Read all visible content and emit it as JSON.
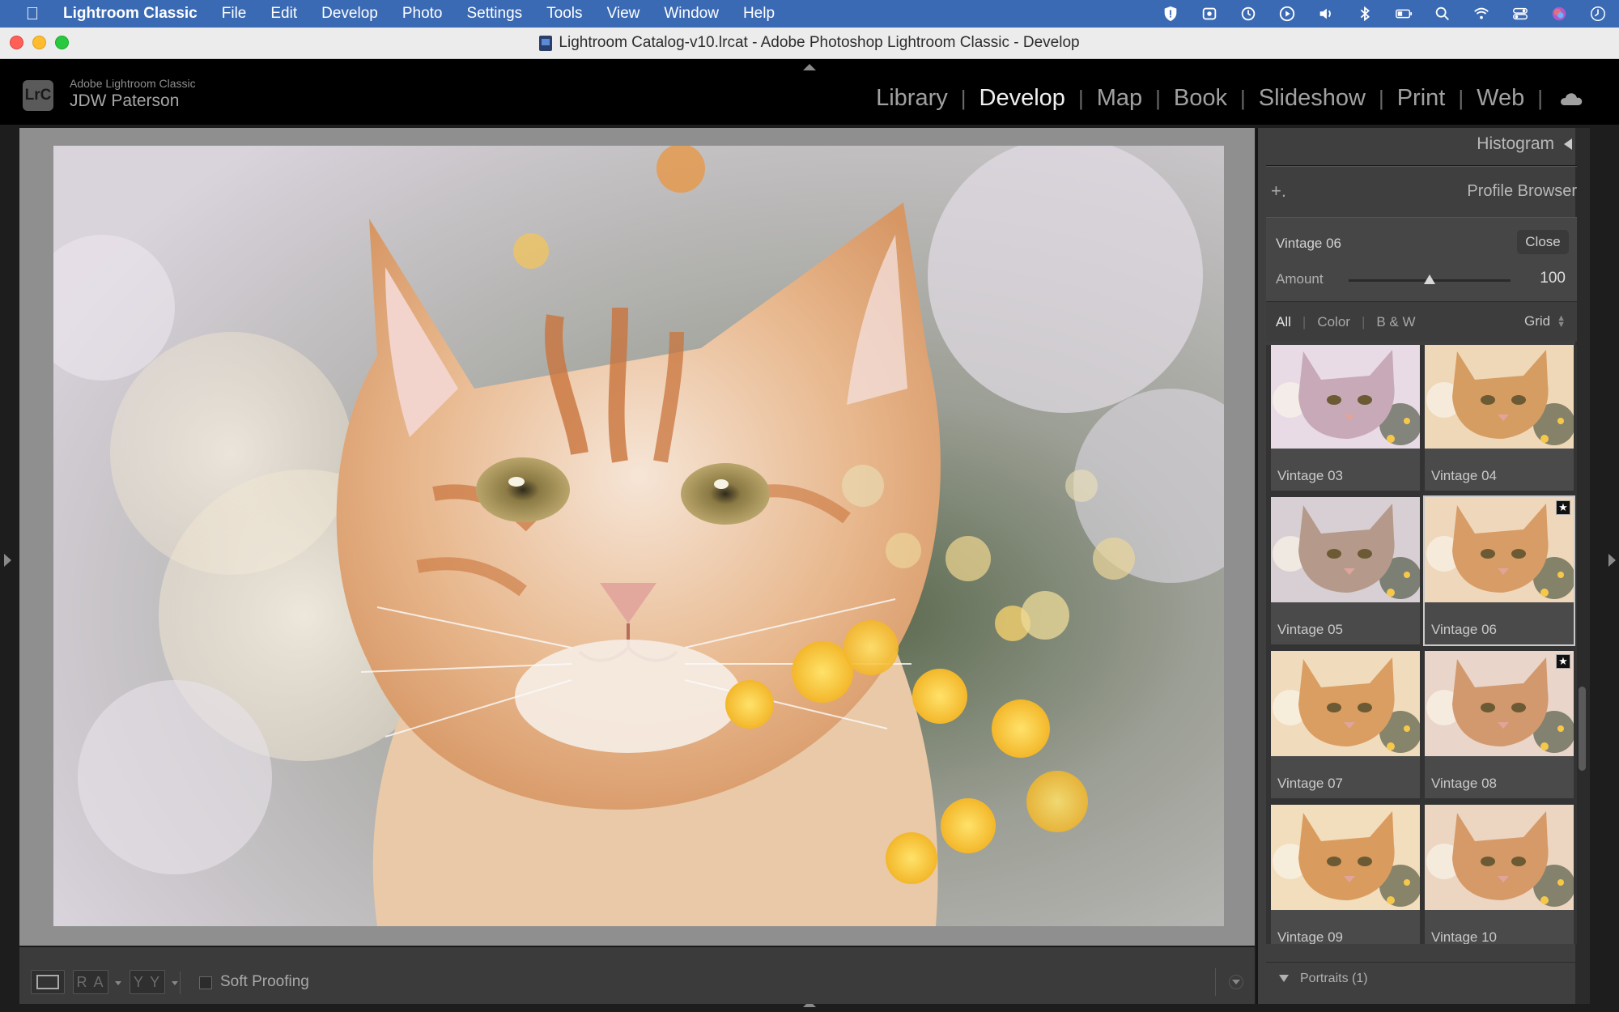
{
  "menubar": {
    "app_name": "Lightroom Classic",
    "items": [
      "File",
      "Edit",
      "Develop",
      "Photo",
      "Settings",
      "Tools",
      "View",
      "Window",
      "Help"
    ]
  },
  "window": {
    "title": "Lightroom Catalog-v10.lrcat - Adobe Photoshop Lightroom Classic - Develop"
  },
  "identity": {
    "logo_text": "LrC",
    "product": "Adobe Lightroom Classic",
    "user": "JDW Paterson"
  },
  "modules": {
    "library": "Library",
    "develop": "Develop",
    "map": "Map",
    "book": "Book",
    "slideshow": "Slideshow",
    "print": "Print",
    "web": "Web",
    "separator": "|",
    "active": "Develop"
  },
  "toolbar": {
    "ra_label": "R A",
    "yy_label": "Y Y",
    "soft_proofing": "Soft Proofing"
  },
  "panel": {
    "histogram_title": "Histogram",
    "profile_browser_title": "Profile Browser",
    "add_symbol": "+.",
    "current_profile": "Vintage 06",
    "close_label": "Close",
    "amount_label": "Amount",
    "amount_value": "100",
    "amount_fraction": 0.5,
    "filters": {
      "all": "All",
      "color": "Color",
      "bw": "B & W",
      "separator": "|",
      "view": "Grid"
    },
    "profiles": [
      {
        "name": "Vintage 03",
        "favorite": false,
        "selected": false
      },
      {
        "name": "Vintage 04",
        "favorite": false,
        "selected": false
      },
      {
        "name": "Vintage 05",
        "favorite": false,
        "selected": false
      },
      {
        "name": "Vintage 06",
        "favorite": true,
        "selected": true
      },
      {
        "name": "Vintage 07",
        "favorite": false,
        "selected": false
      },
      {
        "name": "Vintage 08",
        "favorite": true,
        "selected": false
      },
      {
        "name": "Vintage 09",
        "favorite": false,
        "selected": false
      },
      {
        "name": "Vintage 10",
        "favorite": false,
        "selected": false
      }
    ],
    "group_label": "Portraits (1)"
  },
  "colors": {
    "menubar_blue": "#3b6ab4",
    "panel_bg": "#3f3f3f",
    "canvas_gray": "#8f8f8f"
  }
}
